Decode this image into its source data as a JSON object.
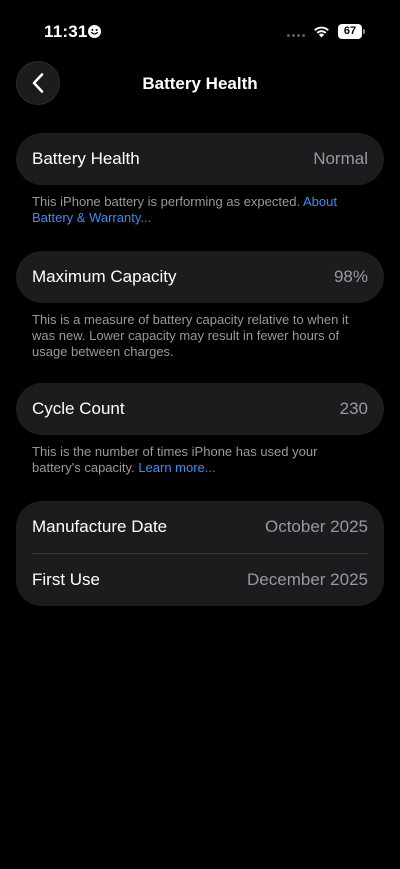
{
  "status_bar": {
    "time": "11:31",
    "battery_level": "67"
  },
  "nav": {
    "title": "Battery Health"
  },
  "battery_health": {
    "label": "Battery Health",
    "value": "Normal",
    "footnote": "This iPhone battery is performing as expected.",
    "link": "About Battery & Warranty..."
  },
  "maximum_capacity": {
    "label": "Maximum Capacity",
    "value": "98%",
    "footnote": "This is a measure of battery capacity relative to when it was new. Lower capacity may result in fewer hours of usage between charges."
  },
  "cycle_count": {
    "label": "Cycle Count",
    "value": "230",
    "footnote": "This is the number of times iPhone has used your battery's capacity.",
    "link": "Learn more..."
  },
  "dates": {
    "manufacture_label": "Manufacture Date",
    "manufacture_value": "October 2025",
    "first_use_label": "First Use",
    "first_use_value": "December 2025"
  },
  "colors": {
    "background": "#000000",
    "card": "#1c1c1e",
    "secondary_text": "#98989f",
    "link": "#3a8df7"
  },
  "icons": {
    "back": "chevron-left-icon",
    "focus": "smiley-icon",
    "wifi": "wifi-icon",
    "battery": "battery-icon",
    "signal": "cellular-signal-icon"
  }
}
